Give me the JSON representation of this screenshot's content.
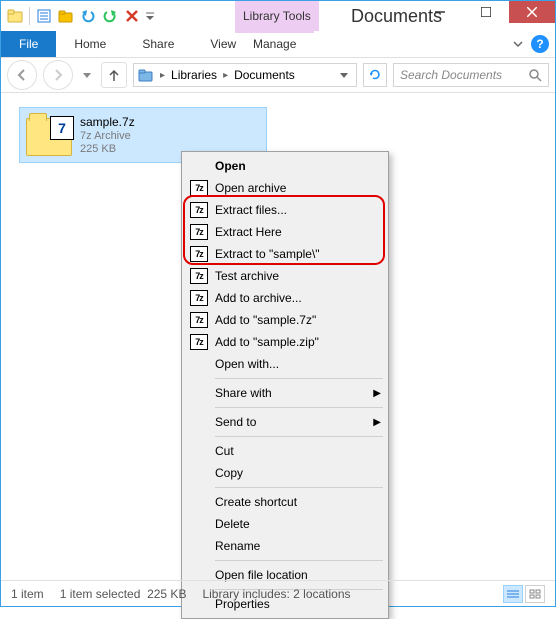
{
  "qat": {
    "icon_labels": [
      "folder-icon",
      "props-icon",
      "new-folder-icon",
      "undo-icon",
      "redo-icon",
      "delete-icon"
    ]
  },
  "titlebar": {
    "contextual_tab_group": "Library Tools",
    "window_title": "Documents"
  },
  "ribbon": {
    "file": "File",
    "tabs": [
      "Home",
      "Share",
      "View"
    ],
    "contextual_tab": "Manage",
    "help_tooltip": "?"
  },
  "address_bar": {
    "segments": [
      "Libraries",
      "Documents"
    ],
    "search_placeholder": "Search Documents"
  },
  "file": {
    "name": "sample.7z",
    "type_label": "7z Archive",
    "size_label": "225 KB"
  },
  "context_menu": {
    "open": "Open",
    "open_archive": "Open archive",
    "extract_files": "Extract files...",
    "extract_here": "Extract Here",
    "extract_to": "Extract to \"sample\\\"",
    "test_archive": "Test archive",
    "add_to_archive": "Add to archive...",
    "add_to_7z": "Add to \"sample.7z\"",
    "add_to_zip": "Add to \"sample.zip\"",
    "open_with": "Open with...",
    "share_with": "Share with",
    "send_to": "Send to",
    "cut": "Cut",
    "copy": "Copy",
    "create_shortcut": "Create shortcut",
    "delete": "Delete",
    "rename": "Rename",
    "open_file_location": "Open file location",
    "properties": "Properties",
    "icon7z_text": "7z"
  },
  "statusbar": {
    "item_count": "1 item",
    "selection": "1 item selected",
    "selection_size": "225 KB",
    "library_info": "Library includes: 2 locations"
  }
}
